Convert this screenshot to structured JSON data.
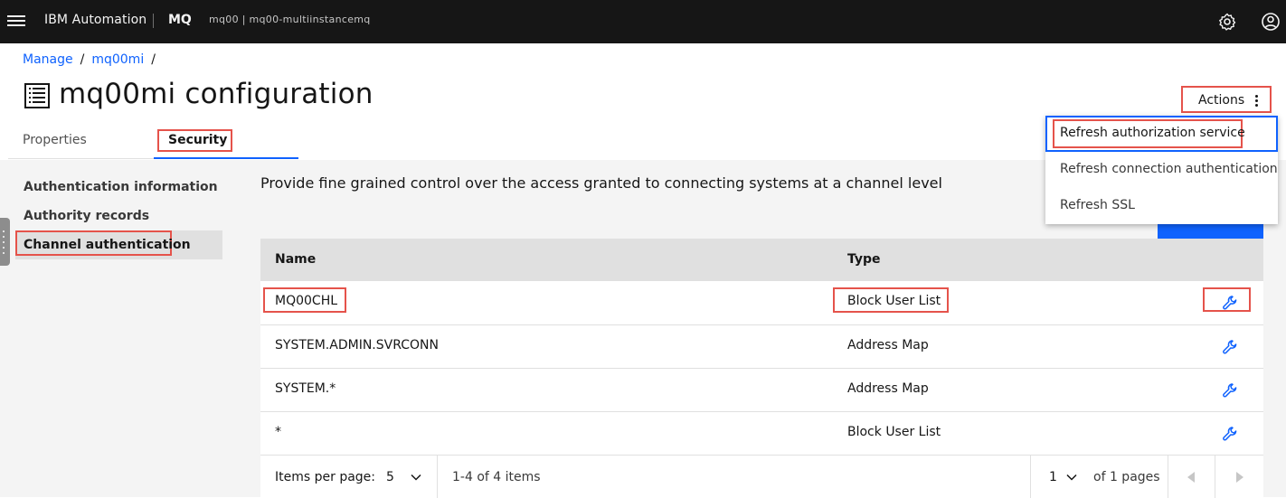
{
  "header": {
    "brand": "IBM Automation",
    "product": "MQ",
    "instance": "mq00 | mq00-multiinstancemq"
  },
  "breadcrumb": {
    "items": [
      "Manage",
      "mq00mi"
    ],
    "separator": "/"
  },
  "page": {
    "title": "mq00mi configuration",
    "actions_label": "Actions"
  },
  "tabs": [
    {
      "label": "Properties"
    },
    {
      "label": "Security"
    }
  ],
  "leftnav": {
    "items": [
      {
        "label": "Authentication information"
      },
      {
        "label": "Authority records"
      },
      {
        "label": "Channel authentication"
      }
    ]
  },
  "main": {
    "description": "Provide fine grained control over the access granted to connecting systems at a channel level"
  },
  "table": {
    "headers": [
      "Name",
      "Type"
    ],
    "rows": [
      {
        "name": "MQ00CHL",
        "type": "Block User List"
      },
      {
        "name": "SYSTEM.ADMIN.SVRCONN",
        "type": "Address Map"
      },
      {
        "name": "SYSTEM.*",
        "type": "Address Map"
      },
      {
        "name": "*",
        "type": "Block User List"
      }
    ],
    "row_action_icon": "wrench-icon"
  },
  "pagination": {
    "items_per_page_label": "Items per page:",
    "page_size": "5",
    "range_text": "1-4 of 4 items",
    "page": "1",
    "of_pages": "of 1 pages"
  },
  "actions_menu": {
    "items": [
      {
        "label": "Refresh authorization service"
      },
      {
        "label": "Refresh connection authentication"
      },
      {
        "label": "Refresh SSL"
      }
    ]
  },
  "colors": {
    "accent": "#0f62fe",
    "highlight": "#e5534b",
    "topbar": "#161616"
  }
}
